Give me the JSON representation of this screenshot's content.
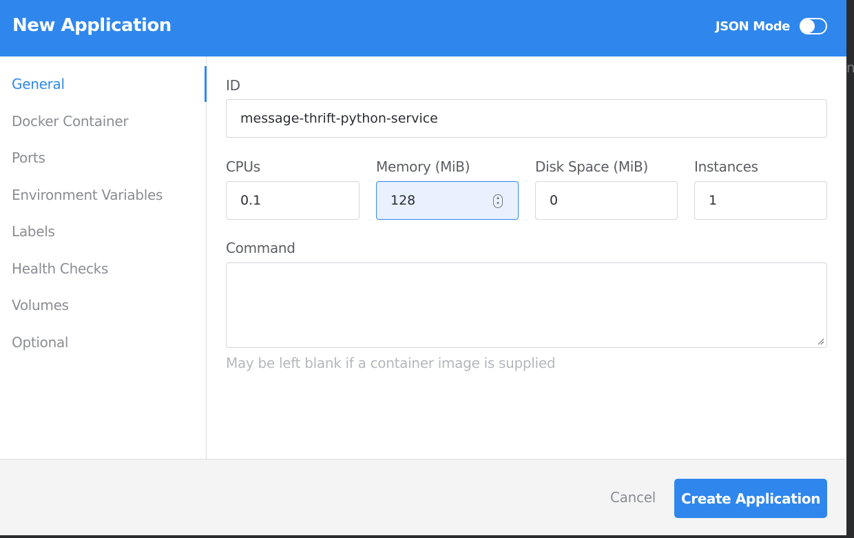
{
  "header": {
    "title": "New Application",
    "json_mode_label": "JSON Mode",
    "json_mode_enabled": false
  },
  "sidebar": {
    "items": [
      {
        "label": "General",
        "active": true
      },
      {
        "label": "Docker Container",
        "active": false
      },
      {
        "label": "Ports",
        "active": false
      },
      {
        "label": "Environment Variables",
        "active": false
      },
      {
        "label": "Labels",
        "active": false
      },
      {
        "label": "Health Checks",
        "active": false
      },
      {
        "label": "Volumes",
        "active": false
      },
      {
        "label": "Optional",
        "active": false
      }
    ]
  },
  "form": {
    "id": {
      "label": "ID",
      "value": "message-thrift-python-service"
    },
    "cpus": {
      "label": "CPUs",
      "value": "0.1"
    },
    "memory": {
      "label": "Memory (MiB)",
      "value": "128"
    },
    "disk": {
      "label": "Disk Space (MiB)",
      "value": "0"
    },
    "instances": {
      "label": "Instances",
      "value": "1"
    },
    "command": {
      "label": "Command",
      "value": "",
      "helper": "May be left blank if a container image is supplied"
    }
  },
  "footer": {
    "cancel_label": "Cancel",
    "create_label": "Create Application"
  },
  "colors": {
    "accent": "#2f87ed",
    "footer_bg": "#f4f4f5",
    "backdrop": "#2a2b2d"
  }
}
